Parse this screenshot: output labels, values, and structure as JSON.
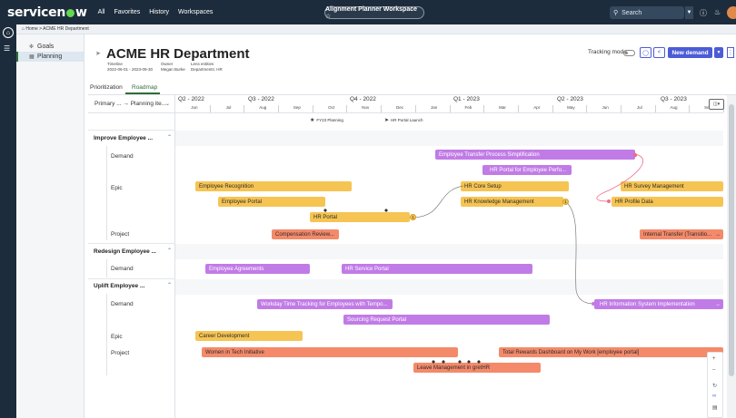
{
  "nav": {
    "logo": "servicenow",
    "links": [
      "All",
      "Favorites",
      "History",
      "Workspaces"
    ],
    "workspace": "Alignment Planner Workspace ☆",
    "search_placeholder": "Search"
  },
  "breadcrumb": "⌂ Home  >  ACME HR Department",
  "sidebar": {
    "items": [
      {
        "label": "Goals",
        "icon": "goals-icon"
      },
      {
        "label": "Planning",
        "icon": "planning-icon"
      }
    ]
  },
  "header": {
    "title": "ACME HR Department",
    "timeline_label": "Timeline",
    "timeline_value": "2022-06-01 - 2023-09-30",
    "owner_label": "Owner",
    "owner_value": "Megan Burke",
    "lens_label": "Lens entities",
    "lens_value": "Departments: HR",
    "tracking_mode": "Tracking mode",
    "new_demand": "New demand"
  },
  "tabs": [
    "Prioritization",
    "Roadmap"
  ],
  "column_header": "Primary ... → Planning ite...",
  "quarters": [
    "Q2 - 2022",
    "Q3 - 2022",
    "Q4 - 2022",
    "Q1 - 2023",
    "Q2 - 2023",
    "Q3 - 2023"
  ],
  "months": [
    "Jun",
    "Jul",
    "Aug",
    "Sep",
    "Oct",
    "Nov",
    "Dec",
    "Jan",
    "Feb",
    "Mar",
    "Apr",
    "May",
    "Jun",
    "Jul",
    "Aug",
    "Sep"
  ],
  "milestones": [
    {
      "label": "FY23 Planning"
    },
    {
      "label": "HR Portal Launch"
    }
  ],
  "groups": [
    {
      "label": "Improve Employee ...",
      "types": [
        "Demand",
        "Epic",
        "Project"
      ]
    },
    {
      "label": "Redesign Employee ...",
      "types": [
        "Demand"
      ]
    },
    {
      "label": "Uplift Employee ...",
      "types": [
        "Demand",
        "Epic",
        "Project"
      ]
    }
  ],
  "bars": {
    "b1": "Employee Transfer Process Simplification",
    "b2": "HR Portal for Employee Perfo...",
    "b3": "Employee Recognition",
    "b4": "HR Core Setup",
    "b5": "HR Survey Management",
    "b6": "Employee Portal",
    "b7": "HR Knowledge Management",
    "b8": "HR Profile Data",
    "b9": "HR Portal",
    "b10": "Compensation Review...",
    "b11": "Internal Transfer (Transitio...",
    "b12": "Employee Agreements",
    "b13": "HR Service Portal",
    "b14": "Workday Time Tracking for Employees with Tempo...",
    "b15": "HR Information System Implementation",
    "b16": "Sourcing Request Portal",
    "b17": "Career Development",
    "b18": "Women in Tech Initiative",
    "b19": "Total Rewards Dashboard on My Work [employee portal]",
    "b20": "Leave Management in gretHR"
  },
  "badges": {
    "n1": "1",
    "n2": "1"
  },
  "colors": {
    "epic": "#f6c453",
    "demand": "#c17be6",
    "project": "#f48a6a",
    "accent": "#4b5cd6",
    "nav": "#1d2c3c"
  }
}
